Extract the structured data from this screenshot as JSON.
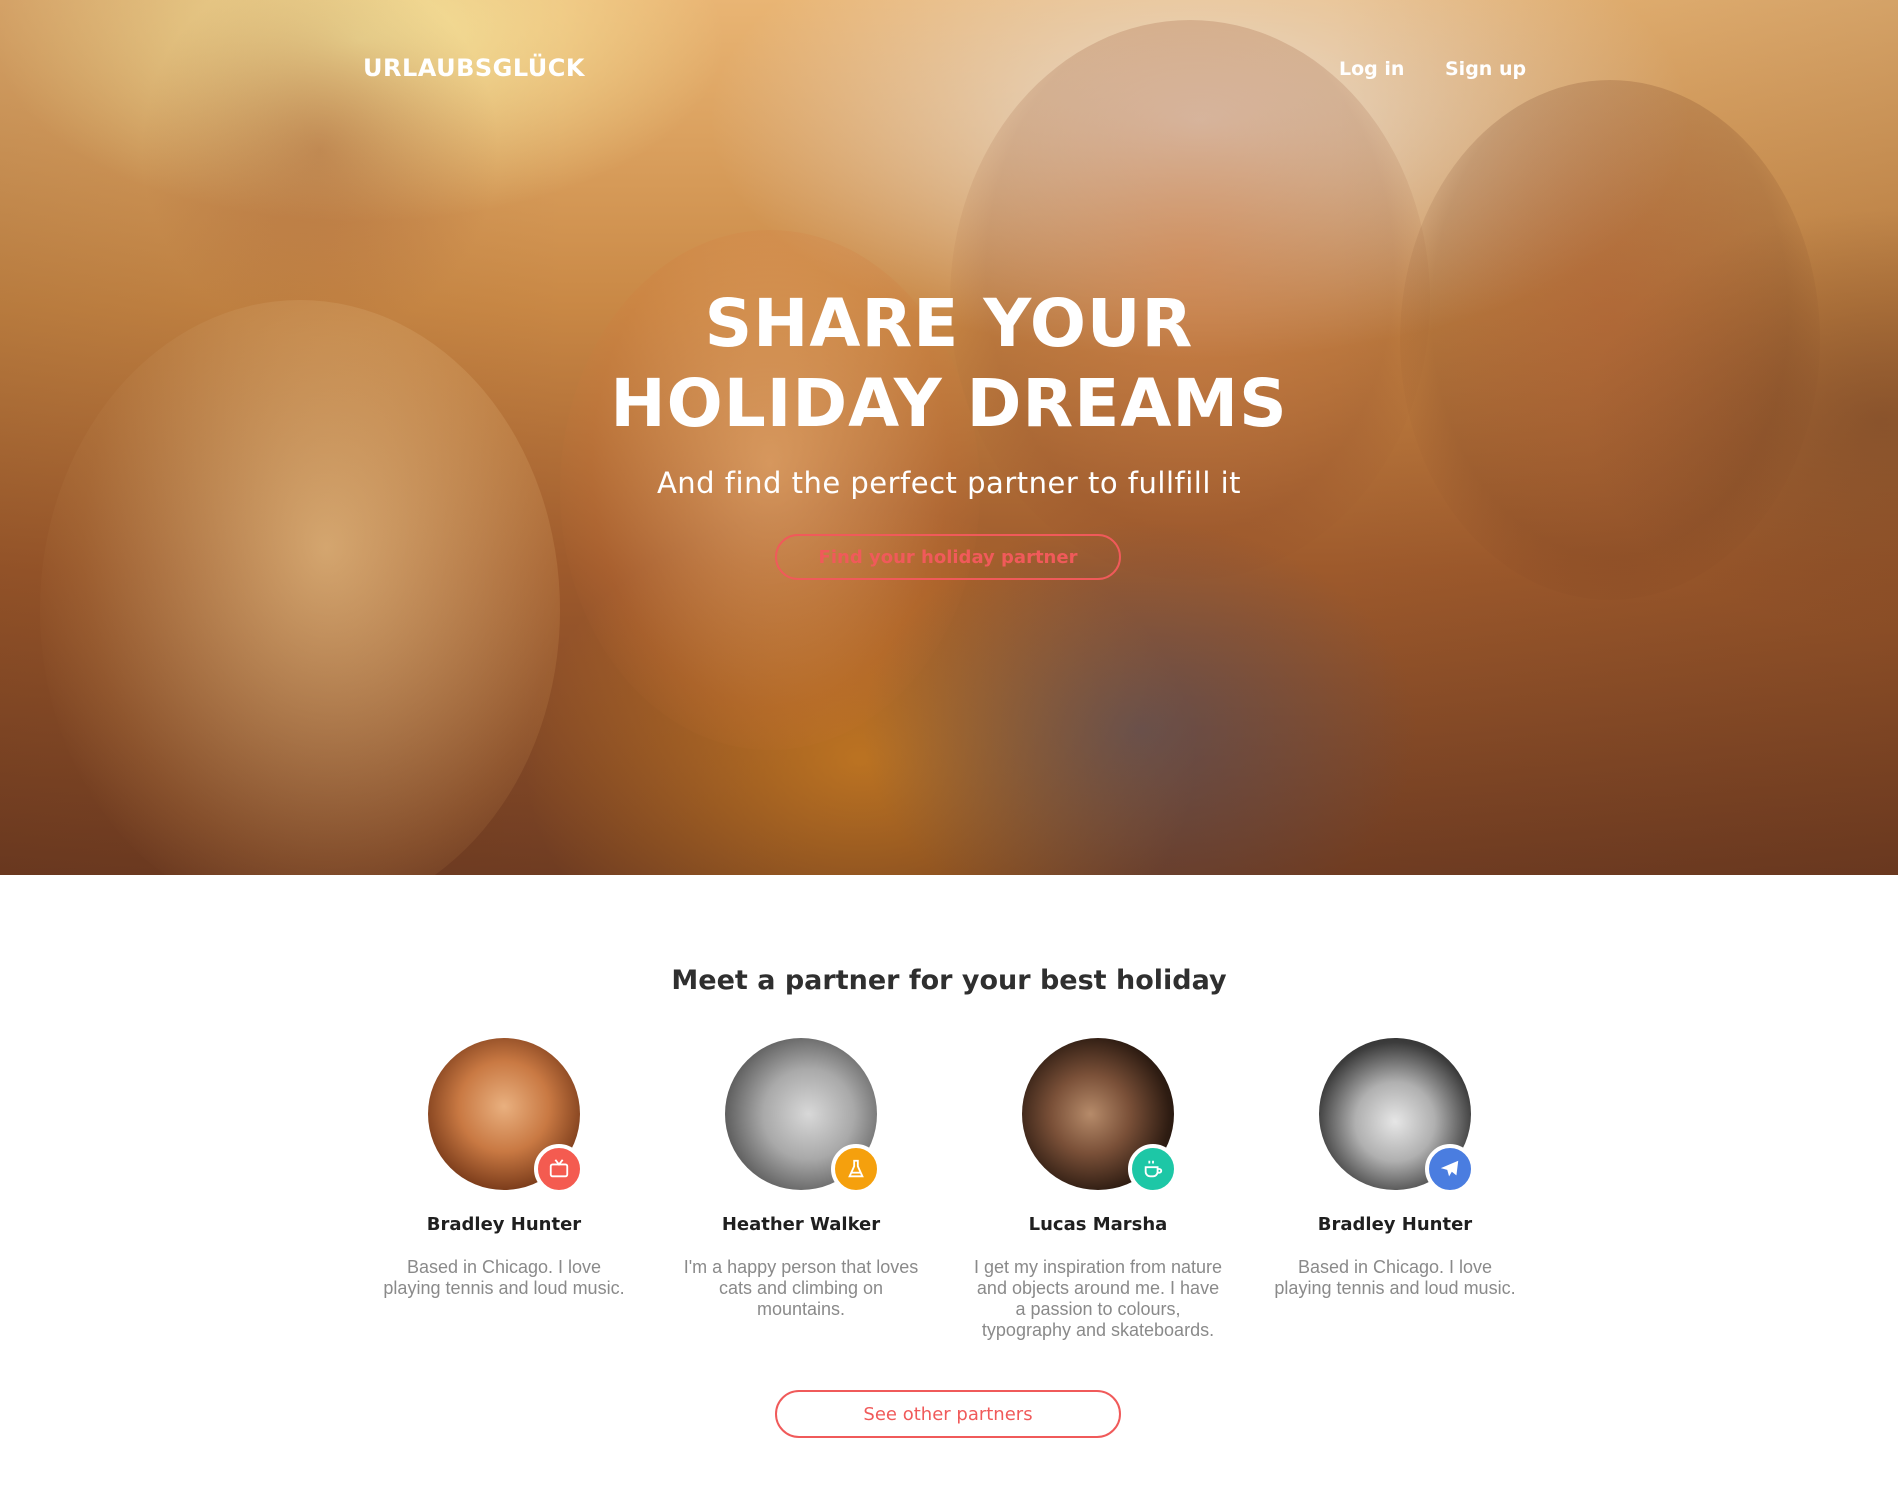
{
  "header": {
    "brand": "URLAUBSGLÜCK",
    "nav": {
      "login": "Log in",
      "signup": "Sign up"
    }
  },
  "hero": {
    "title_line1": "SHARE YOUR",
    "title_line2": "HOLIDAY DREAMS",
    "subtitle": "And find the perfect partner to fullfill it",
    "cta": "Find your holiday partner"
  },
  "partners": {
    "title": "Meet a partner for your best holiday",
    "items": [
      {
        "name": "Bradley Hunter",
        "bio": "Based in Chicago. I love playing tennis and loud music.",
        "badge_icon": "tv-icon",
        "badge_color": "#f45b50"
      },
      {
        "name": "Heather Walker",
        "bio": "I'm a happy person that loves cats and climbing on mountains.",
        "badge_icon": "flask-icon",
        "badge_color": "#f5a00d"
      },
      {
        "name": "Lucas Marsha",
        "bio": "I get my inspiration from nature and objects around me. I have a passion to colours, typography and skateboards.",
        "badge_icon": "coffee-icon",
        "badge_color": "#1dc7a6"
      },
      {
        "name": "Bradley Hunter",
        "bio": "Based in Chicago. I love playing tennis and loud music.",
        "badge_icon": "paper-plane-icon",
        "badge_color": "#4a7de0"
      }
    ],
    "more_button": "See other partners"
  },
  "colors": {
    "accent": "#f05a5a",
    "heading": "#2f2f2f",
    "muted_text": "#8a8a8a"
  }
}
